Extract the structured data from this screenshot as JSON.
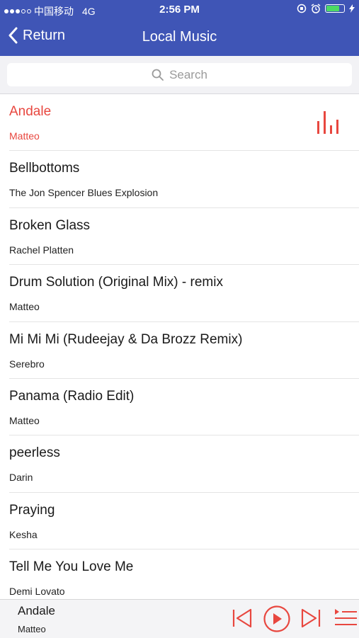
{
  "status": {
    "carrier": "中国移动",
    "network": "4G",
    "time": "2:56 PM"
  },
  "nav": {
    "back_label": "Return",
    "title": "Local Music"
  },
  "search": {
    "placeholder": "Search"
  },
  "songs": [
    {
      "title": "Andale",
      "artist": "Matteo",
      "playing": true
    },
    {
      "title": "Bellbottoms",
      "artist": "The Jon Spencer Blues Explosion"
    },
    {
      "title": "Broken Glass",
      "artist": "Rachel Platten"
    },
    {
      "title": "Drum Solution (Original Mix) - remix",
      "artist": "Matteo"
    },
    {
      "title": "Mi Mi Mi (Rudeejay & Da Brozz Remix)",
      "artist": "Serebro"
    },
    {
      "title": "Panama (Radio Edit)",
      "artist": "Matteo"
    },
    {
      "title": "peerless",
      "artist": "Darin"
    },
    {
      "title": "Praying",
      "artist": "Kesha"
    },
    {
      "title": "Tell Me You Love Me",
      "artist": "Demi Lovato"
    }
  ],
  "now_playing": {
    "title": "Andale",
    "artist": "Matteo"
  },
  "colors": {
    "header": "#3f55b6",
    "accent": "#e8473f"
  },
  "icons": [
    "back-chevron-icon",
    "search-icon",
    "equalizer-icon",
    "previous-icon",
    "play-icon",
    "next-icon",
    "playlist-icon"
  ]
}
